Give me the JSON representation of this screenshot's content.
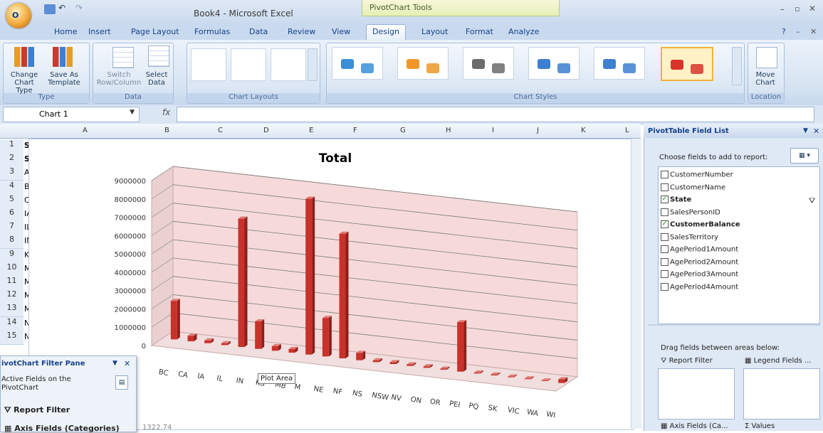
{
  "window": {
    "title": "Book4 - Microsoft Excel",
    "context_tab_group": "PivotChart Tools"
  },
  "tabs": [
    "Home",
    "Insert",
    "Page Layout",
    "Formulas",
    "Data",
    "Review",
    "View",
    "Design",
    "Layout",
    "Format",
    "Analyze"
  ],
  "active_tab": "Design",
  "ribbon": {
    "groups": {
      "type": "Type",
      "data": "Data",
      "layouts": "Chart Layouts",
      "styles": "Chart Styles",
      "location": "Location"
    },
    "buttons": {
      "change_chart_type_1": "Change",
      "change_chart_type_2": "Chart Type",
      "save_template_1": "Save As",
      "save_template_2": "Template",
      "switch_1": "Switch",
      "switch_2": "Row/Column",
      "select_data_1": "Select",
      "select_data_2": "Data",
      "move_chart_1": "Move",
      "move_chart_2": "Chart"
    },
    "style_colors": [
      "#3a8fd6",
      "#f0962a",
      "#6b6b6b",
      "#3d7fd0",
      "#3d7fd0",
      "#d9342b"
    ]
  },
  "formula_bar": {
    "name_box": "Chart 1",
    "fx": "fx",
    "value": ""
  },
  "columns": [
    "A",
    "B",
    "C",
    "D",
    "E",
    "F",
    "G",
    "H",
    "I",
    "J",
    "K",
    "L"
  ],
  "rows": [
    {
      "n": "1",
      "a": "Sum"
    },
    {
      "n": "2",
      "a": "State"
    },
    {
      "n": "3",
      "a": "AB"
    },
    {
      "n": "4",
      "a": "BC"
    },
    {
      "n": "5",
      "a": "CA"
    },
    {
      "n": "6",
      "a": "IA"
    },
    {
      "n": "7",
      "a": "IL"
    },
    {
      "n": "8",
      "a": "IN"
    },
    {
      "n": "9",
      "a": "KS"
    },
    {
      "n": "10",
      "a": "MB"
    },
    {
      "n": "11",
      "a": "MI"
    },
    {
      "n": "12",
      "a": "MN"
    },
    {
      "n": "13",
      "a": "MO"
    },
    {
      "n": "14",
      "a": "NE"
    },
    {
      "n": "15",
      "a": "NF"
    }
  ],
  "bottom_cell": "1322.74",
  "chart_data": {
    "type": "bar",
    "title": "Total",
    "ylim": [
      0,
      9000000
    ],
    "yticks": [
      "0",
      "1000000",
      "2000000",
      "3000000",
      "4000000",
      "5000000",
      "6000000",
      "7000000",
      "8000000",
      "9000000"
    ],
    "categories": [
      "AB",
      "BC",
      "CA",
      "IA",
      "IL",
      "IN",
      "KS",
      "MB",
      "MI",
      "MN",
      "MO",
      "NE",
      "NF",
      "NS",
      "NSW",
      "NV",
      "ON",
      "OR",
      "PEI",
      "PQ",
      "SK",
      "VIC",
      "WA",
      "WI"
    ],
    "values": [
      2100000,
      300000,
      150000,
      100000,
      7000000,
      1500000,
      250000,
      200000,
      8500000,
      2100000,
      6800000,
      400000,
      100000,
      100000,
      80000,
      80000,
      60000,
      2700000,
      50000,
      50000,
      40000,
      40000,
      30000,
      200000
    ],
    "axis_labels_shown": [
      "BC",
      "CA",
      "IA",
      "IL",
      "IN",
      "KS",
      "MB",
      "M",
      "NE",
      "NF",
      "NS",
      "NSW",
      "NV",
      "ON",
      "OR",
      "PEI",
      "PQ",
      "SK",
      "VIC",
      "WA",
      "WI"
    ],
    "bar_color": "#c8322b",
    "wall_color": "#f6dada",
    "grid": true
  },
  "tooltip": "Plot Area",
  "field_list": {
    "title": "PivotTable Field List",
    "choose_label": "Choose fields to add to report:",
    "fields": [
      {
        "name": "CustomerNumber",
        "checked": false
      },
      {
        "name": "CustomerName",
        "checked": false
      },
      {
        "name": "State",
        "checked": true
      },
      {
        "name": "SalesPersonID",
        "checked": false
      },
      {
        "name": "CustomerBalance",
        "checked": true
      },
      {
        "name": "SalesTerritory",
        "checked": false
      },
      {
        "name": "AgePeriod1Amount",
        "checked": false
      },
      {
        "name": "AgePeriod2Amount",
        "checked": false
      },
      {
        "name": "AgePeriod3Amount",
        "checked": false
      },
      {
        "name": "AgePeriod4Amount",
        "checked": false
      }
    ],
    "drag_label": "Drag fields between areas below:",
    "report_filter": "Report Filter",
    "legend_fields": "Legend Fields ...",
    "axis_fields": "Axis Fields (Ca...",
    "values": "Values"
  },
  "filter_pane": {
    "title": "ivotChart Filter Pane",
    "active_fields": "Active Fields on the PivotChart",
    "report_filter": "Report Filter",
    "axis_fields": "Axis Fields (Categories)"
  }
}
